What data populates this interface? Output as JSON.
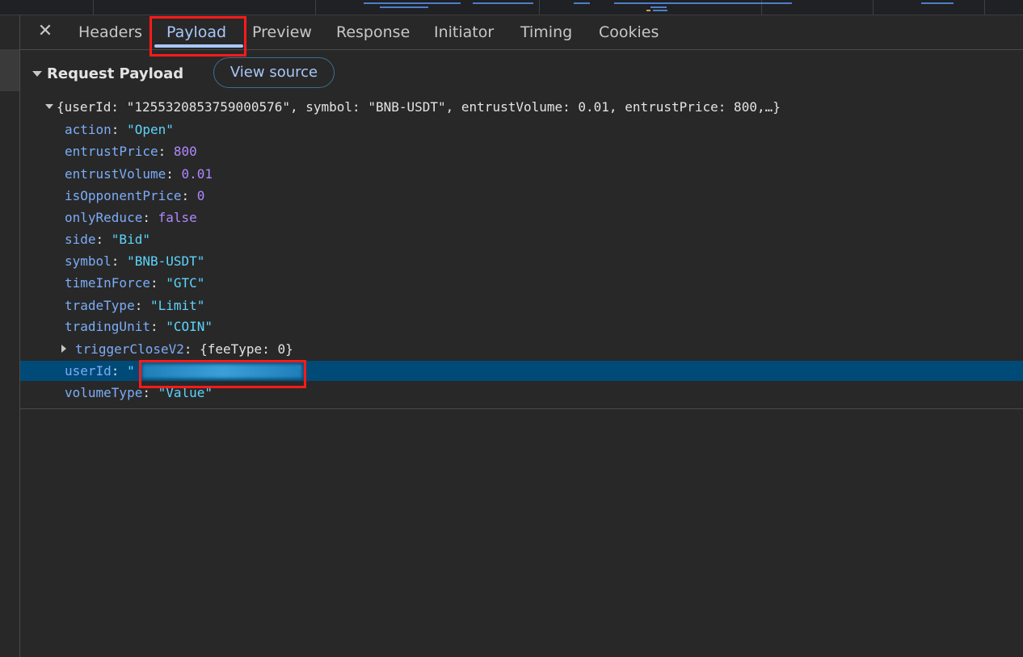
{
  "tabs": {
    "items": [
      {
        "label": "Headers"
      },
      {
        "label": "Payload"
      },
      {
        "label": "Preview"
      },
      {
        "label": "Response"
      },
      {
        "label": "Initiator"
      },
      {
        "label": "Timing"
      },
      {
        "label": "Cookies"
      }
    ],
    "active": "Payload"
  },
  "section": {
    "title": "Request Payload",
    "view_source_label": "View source"
  },
  "payload": {
    "summary": "{userId: \"1255320853759000576\", symbol: \"BNB-USDT\", entrustVolume: 0.01, entrustPrice: 800,…}",
    "properties": [
      {
        "key": "action",
        "value": "\"Open\"",
        "type": "string"
      },
      {
        "key": "entrustPrice",
        "value": "800",
        "type": "number"
      },
      {
        "key": "entrustVolume",
        "value": "0.01",
        "type": "number"
      },
      {
        "key": "isOpponentPrice",
        "value": "0",
        "type": "number"
      },
      {
        "key": "onlyReduce",
        "value": "false",
        "type": "boolean"
      },
      {
        "key": "side",
        "value": "\"Bid\"",
        "type": "string"
      },
      {
        "key": "symbol",
        "value": "\"BNB-USDT\"",
        "type": "string"
      },
      {
        "key": "timeInForce",
        "value": "\"GTC\"",
        "type": "string"
      },
      {
        "key": "tradeType",
        "value": "\"Limit\"",
        "type": "string"
      },
      {
        "key": "tradingUnit",
        "value": "\"COIN\"",
        "type": "string"
      }
    ],
    "trigger": {
      "key": "triggerCloseV2",
      "value": "{feeType: 0}"
    },
    "user_id": {
      "key": "userId",
      "open_quote": "\"",
      "close_quote": "\""
    },
    "volume_type": {
      "key": "volumeType",
      "value": "\"Value\""
    }
  },
  "colors": {
    "background": "#282828",
    "accent": "#a8c7fa",
    "key": "#7cacf8",
    "string": "#5cd5fb",
    "number": "#b088ff",
    "selection": "#004a77",
    "annotation": "#ff1a1a"
  },
  "icons": {
    "close": "close-icon",
    "expand": "triangle-down-icon",
    "collapse": "triangle-right-icon"
  }
}
